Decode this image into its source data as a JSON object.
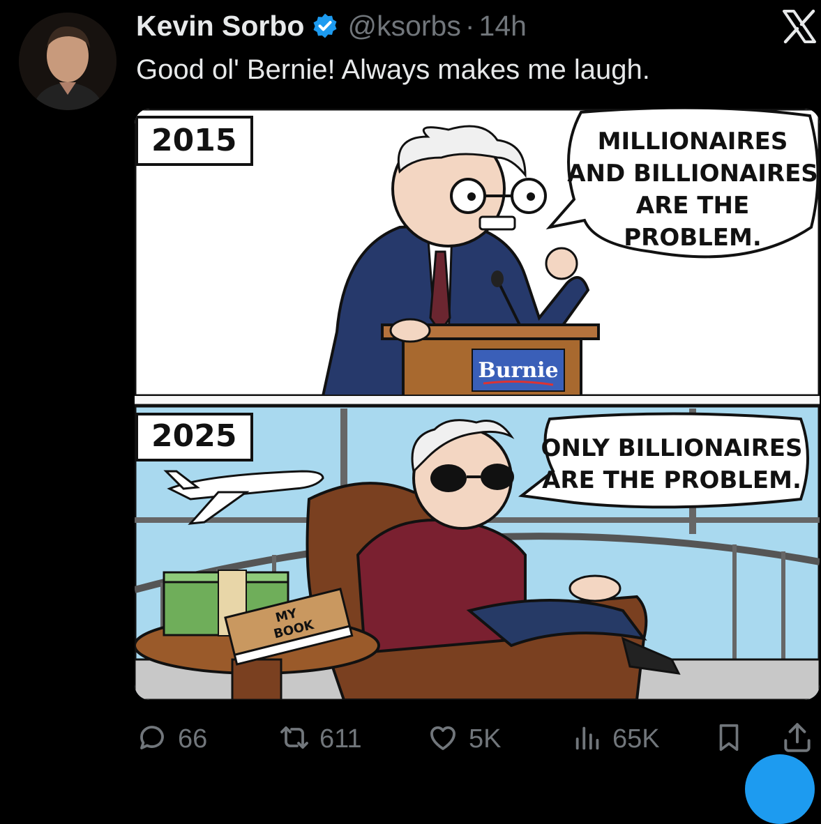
{
  "tweet": {
    "author_name": "Kevin Sorbo",
    "handle": "@ksorbs",
    "separator": "·",
    "time": "14h",
    "text": "Good ol' Bernie!  Always makes me laugh.",
    "verified": true
  },
  "media": {
    "panel_top": {
      "year": "2015",
      "speech": [
        "MILLIONAIRES",
        "AND BILLIONAIRES",
        "ARE THE",
        "PROBLEM."
      ],
      "podium_sign": "Burnie",
      "background": "#ffffff"
    },
    "panel_bottom": {
      "year": "2025",
      "speech": [
        "ONLY BILLIONAIRES",
        "ARE THE PROBLEM."
      ],
      "book_label": [
        "MY",
        "BOOK"
      ],
      "sky": "#a9d9ef"
    }
  },
  "actions": {
    "replies": "66",
    "reposts": "611",
    "likes": "5K",
    "views": "65K"
  },
  "icons": [
    "verified-badge-icon",
    "x-logo-icon",
    "reply-icon",
    "repost-icon",
    "like-icon",
    "views-icon",
    "bookmark-icon",
    "share-icon"
  ],
  "colors": {
    "background": "#000000",
    "text": "#e7e9ea",
    "muted": "#71767b",
    "accent": "#1d9bf0"
  }
}
